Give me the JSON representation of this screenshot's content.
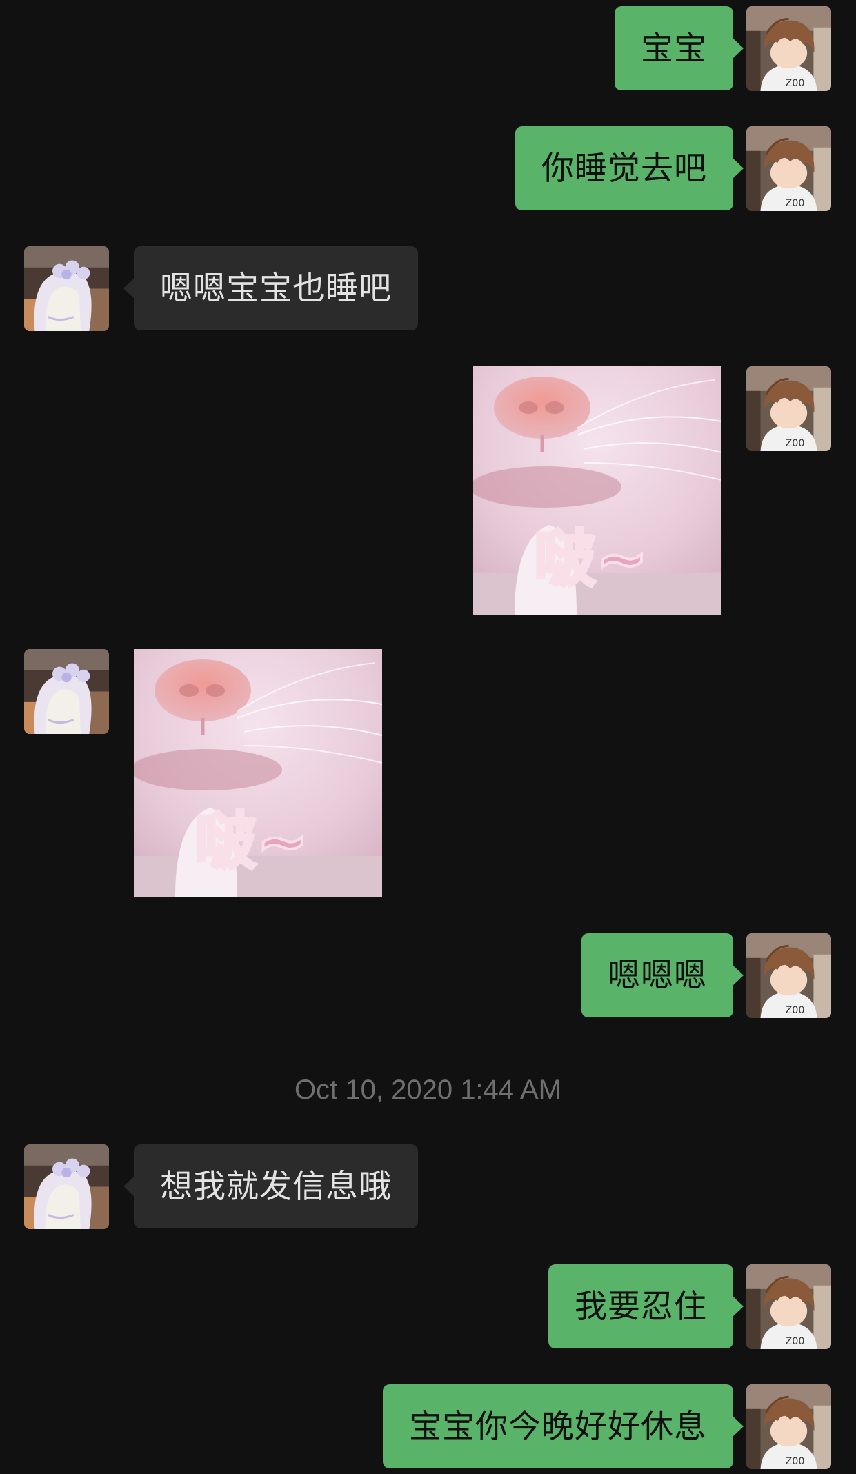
{
  "messages": [
    {
      "sender": "me",
      "type": "text",
      "text": "宝宝"
    },
    {
      "sender": "me",
      "type": "text",
      "text": "你睡觉去吧"
    },
    {
      "sender": "them",
      "type": "text",
      "text": "嗯嗯宝宝也睡吧"
    },
    {
      "sender": "me",
      "type": "sticker",
      "caption": "啵~"
    },
    {
      "sender": "them",
      "type": "sticker",
      "caption": "啵~"
    },
    {
      "sender": "me",
      "type": "text",
      "text": "嗯嗯嗯"
    },
    {
      "sender": "them",
      "type": "text",
      "text": "想我就发信息哦"
    },
    {
      "sender": "me",
      "type": "text",
      "text": "我要忍住"
    },
    {
      "sender": "me",
      "type": "text",
      "text": "宝宝你今晚好好休息"
    }
  ],
  "timestamp": "Oct 10, 2020 1:44 AM",
  "colors": {
    "background": "#111111",
    "my_bubble": "#59b46a",
    "their_bubble": "#2b2b2b",
    "timestamp_text": "#6f6f6f"
  },
  "icons": {
    "my_avatar": "anime-boy-avatar",
    "their_avatar": "anime-girl-avatar",
    "sticker": "cat-nose-kiss-sticker"
  }
}
